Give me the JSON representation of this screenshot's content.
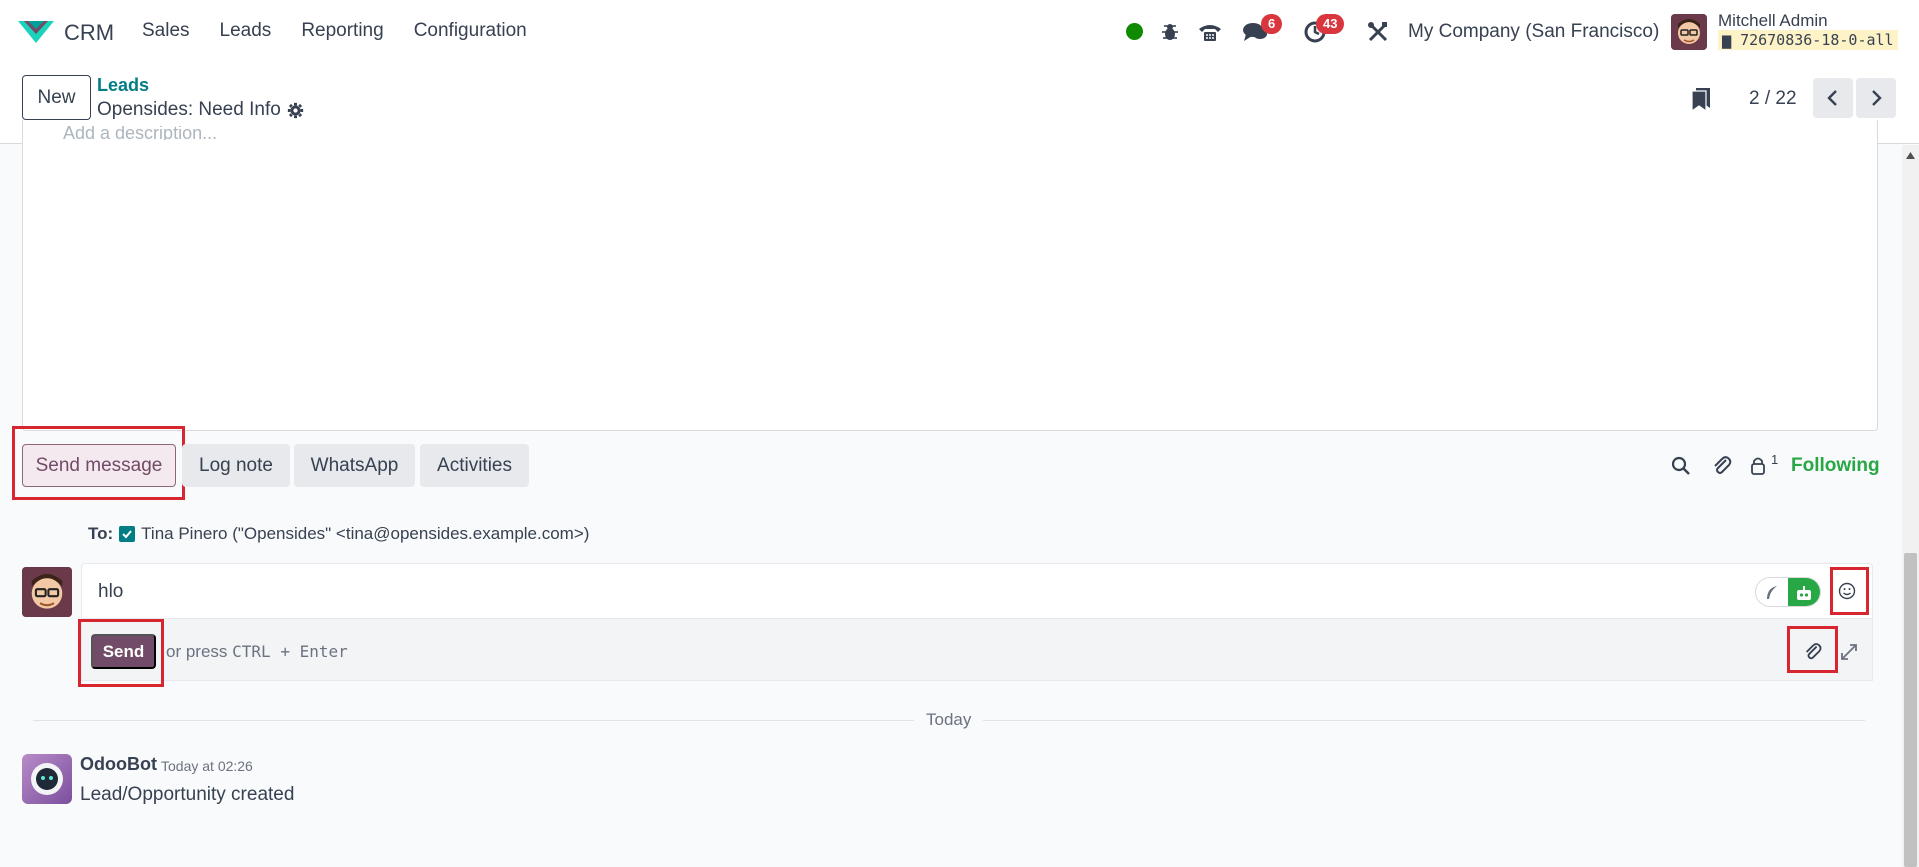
{
  "navbar": {
    "app_name": "CRM",
    "menu": [
      "Sales",
      "Leads",
      "Reporting",
      "Configuration"
    ],
    "messages_badge": "6",
    "activities_badge": "43",
    "company": "My Company (San Francisco)",
    "user_name": "Mitchell Admin",
    "db_name": "72670836-18-0-all"
  },
  "control": {
    "new_label": "New",
    "breadcrumb_parent": "Leads",
    "record_name": "Opensides: Need Info",
    "pager": "2 / 22"
  },
  "description": {
    "placeholder": "Add a description..."
  },
  "chatter": {
    "tabs": [
      "Send message",
      "Log note",
      "WhatsApp",
      "Activities"
    ],
    "followers_count": "1",
    "following_label": "Following"
  },
  "composer": {
    "to_label": "To:",
    "recipient": "Tina Pinero (\"Opensides\" <tina@opensides.example.com>)",
    "text": "hlo",
    "send_label": "Send",
    "hint_prefix": "or press",
    "hint_keys": "CTRL + Enter"
  },
  "messages": {
    "date_divider": "Today",
    "items": [
      {
        "author": "OdooBot",
        "time": "Today at 02:26",
        "body": "Lead/Opportunity created"
      }
    ]
  },
  "colors": {
    "brand": "#714b67",
    "teal": "#017e84",
    "following": "#28a745",
    "badge": "#d9363e",
    "highlight": "#d7262f"
  }
}
